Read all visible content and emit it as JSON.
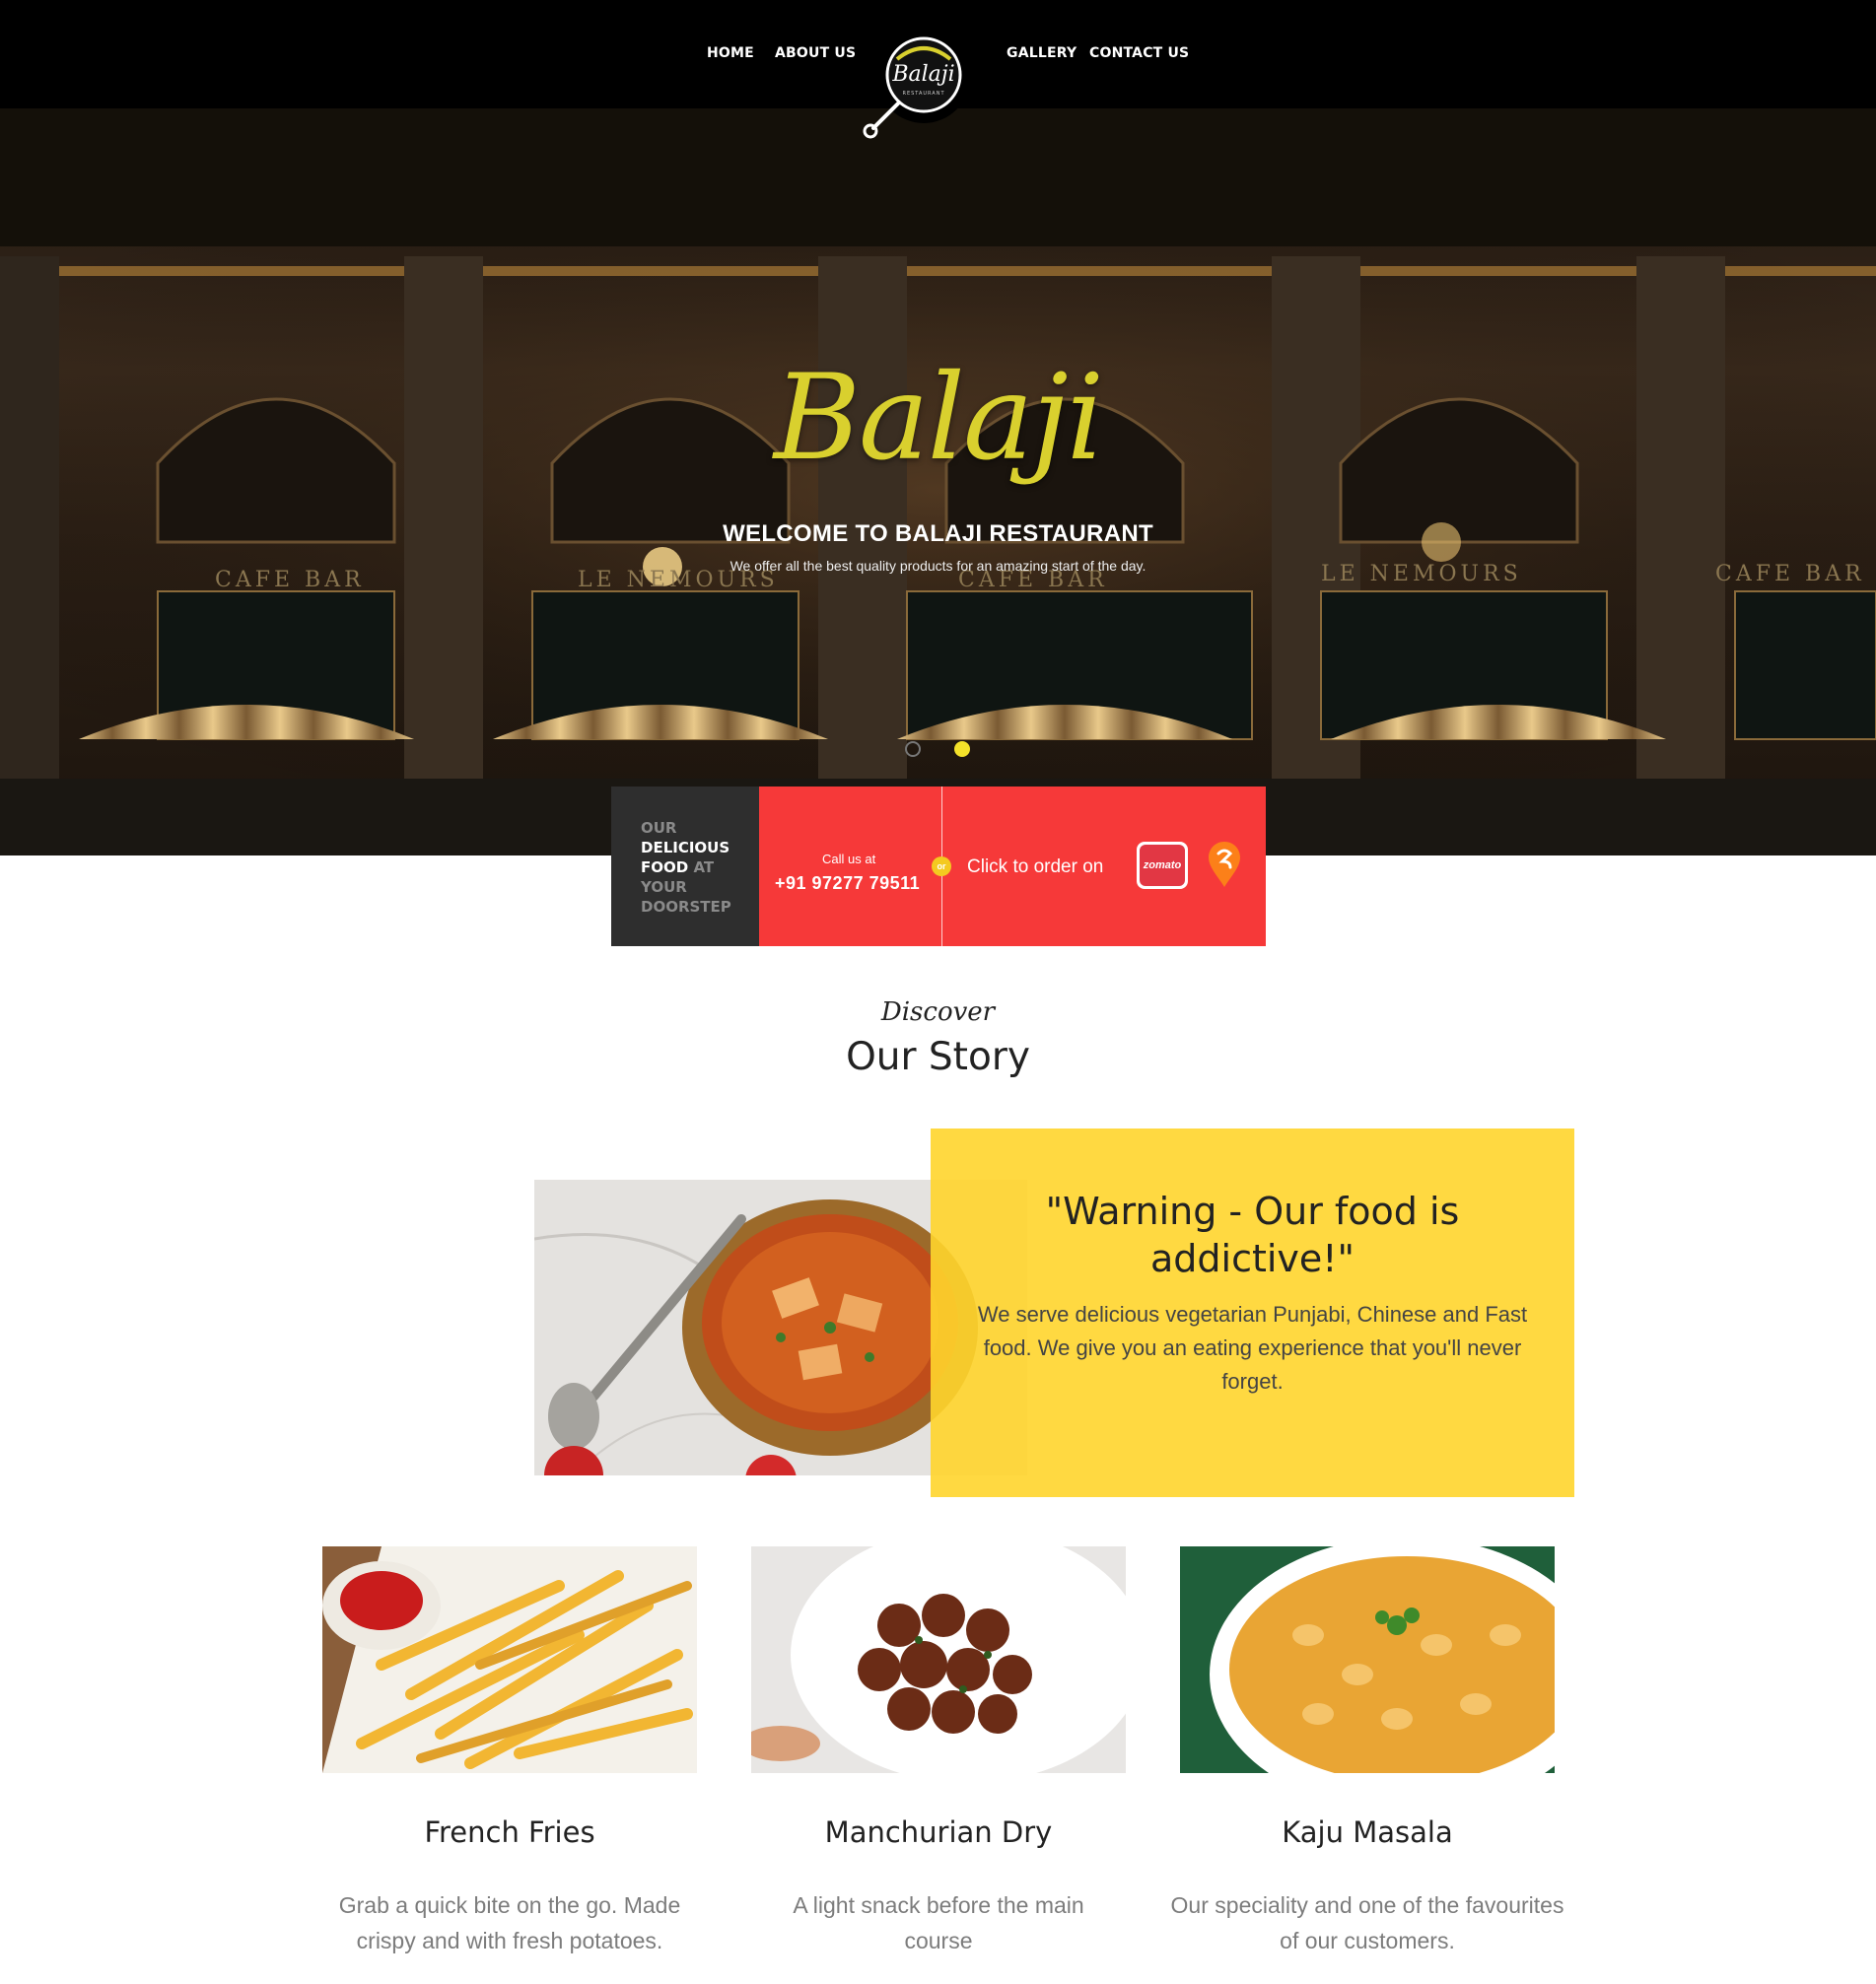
{
  "nav": {
    "items": [
      {
        "label": "HOME"
      },
      {
        "label": "ABOUT US"
      },
      {
        "label": "GALLERY"
      },
      {
        "label": "CONTACT US"
      }
    ],
    "logo_text": "Balaji",
    "logo_subtext": "RESTAURANT"
  },
  "hero": {
    "script_title": "Balaji",
    "title": "WELCOME TO BALAJI RESTAURANT",
    "subtitle": "We offer all the best quality products for an amazing start of the day.",
    "signs": [
      "CAFE BAR",
      "LE NEMOURS",
      "CAFE BAR",
      "LE NEMOURS",
      "CAFE BAR"
    ],
    "slider_dots": 2,
    "active_dot": 2
  },
  "order_bar": {
    "tagline_1": "OUR",
    "tagline_2": "DELICIOUS",
    "tagline_3": "FOOD",
    "tagline_4": "AT",
    "tagline_5": "YOUR",
    "tagline_6": "DOORSTEP",
    "call_label": "Call us at",
    "phone": "+91 97277 79511",
    "or_label": "or",
    "click_label": "Click to order on",
    "zomato_label": "zomato"
  },
  "story": {
    "discover": "Discover",
    "title": "Our Story",
    "quote": "\"Warning - Our food is addictive!\"",
    "text": "We serve delicious vegetarian Punjabi, Chinese and Fast food. We give you an eating experience that you'll never forget."
  },
  "dishes": [
    {
      "name": "French Fries",
      "desc": "Grab a quick bite on the go. Made crispy and with fresh potatoes."
    },
    {
      "name": "Manchurian Dry",
      "desc": "A light snack before the main course"
    },
    {
      "name": "Kaju Masala",
      "desc": "Our speciality and one of the favourites of our customers."
    }
  ],
  "colors": {
    "nav_bg": "#000000",
    "accent_yellow": "#ffd52c",
    "order_red": "#f63939",
    "order_dark": "#2e2e2e",
    "script_yellow": "#d9d02e"
  }
}
